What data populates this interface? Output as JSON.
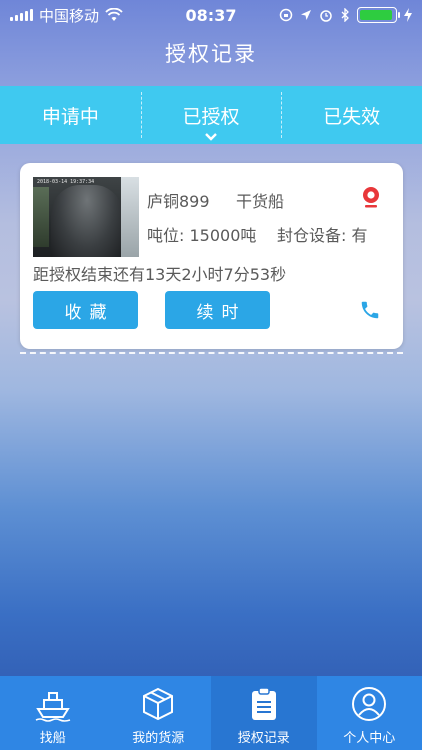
{
  "status_bar": {
    "carrier": "中国移动",
    "time": "08:37",
    "battery_level": 0.95
  },
  "title": "授权记录",
  "tabs": [
    {
      "label": "申请中",
      "active": false
    },
    {
      "label": "已授权",
      "active": true
    },
    {
      "label": "已失效",
      "active": false
    }
  ],
  "card": {
    "ship_name": "庐铜899",
    "ship_type": "干货船",
    "tonnage": "吨位: 15000吨",
    "seal_equipment": "封仓设备: 有",
    "countdown": "距授权结束还有13天2小时7分53秒",
    "favorite_label": "收藏",
    "renew_label": "续时",
    "photo_stamp": "2018-03-14  19:37:34"
  },
  "bottom_nav": [
    {
      "label": "找船",
      "icon": "ship-icon",
      "active": false
    },
    {
      "label": "我的货源",
      "icon": "box-icon",
      "active": false
    },
    {
      "label": "授权记录",
      "icon": "clipboard-icon",
      "active": true
    },
    {
      "label": "个人中心",
      "icon": "user-icon",
      "active": false
    }
  ],
  "colors": {
    "tab_bar": "#3fc9f0",
    "button": "#2ba6e6",
    "nav_bar": "#2f86e4",
    "location_accent": "#e8373a",
    "battery": "#2ecc40"
  }
}
